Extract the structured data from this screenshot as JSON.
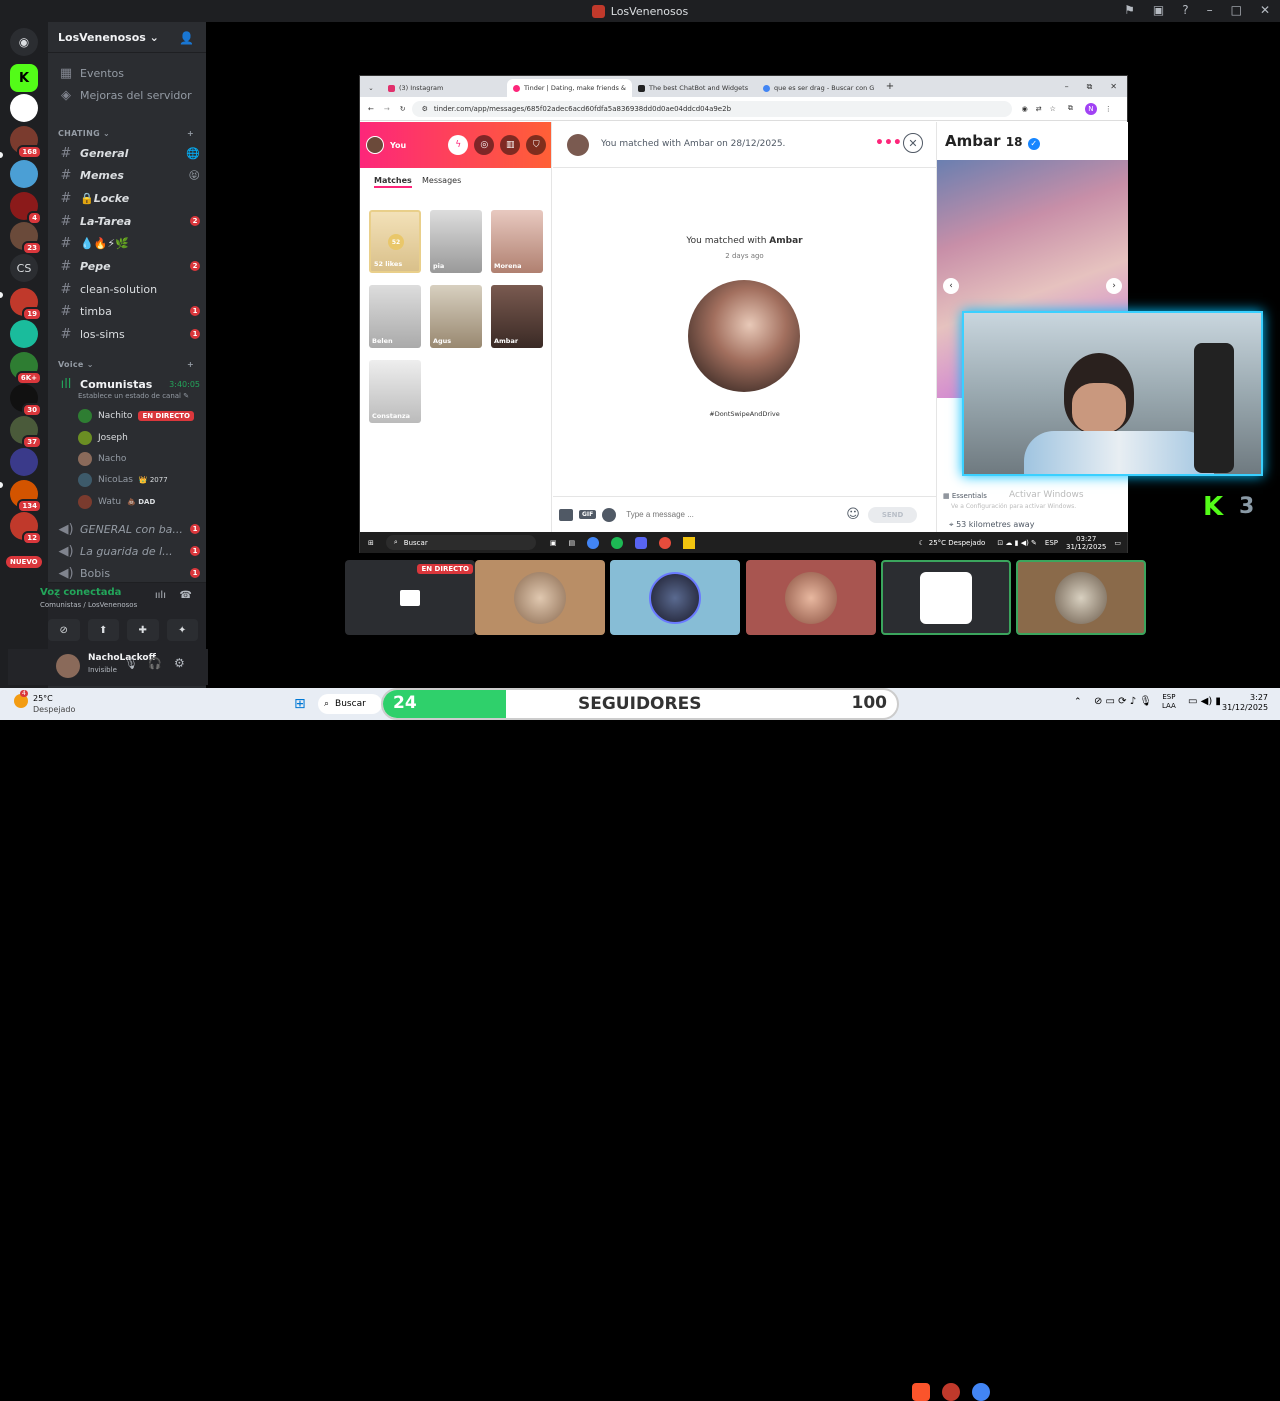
{
  "window_title": "LosVenenosos",
  "server": {
    "name": "LosVenenosos"
  },
  "sidebar_top": [
    {
      "label": "Eventos"
    },
    {
      "label": "Mejoras del servidor"
    }
  ],
  "categories": {
    "text": "CHATING",
    "voice": "Voice"
  },
  "channels": [
    {
      "name": "General",
      "emoji": "🌐",
      "count": ""
    },
    {
      "name": "Memes",
      "emoji": "😝",
      "count": ""
    },
    {
      "name": "Locke",
      "emoji": "🔒",
      "count": ""
    },
    {
      "name": "La-Tarea",
      "emoji": "",
      "count": "2"
    },
    {
      "name": "💧🔥⚡🌿",
      "emoji": "",
      "count": ""
    },
    {
      "name": "Pepe",
      "emoji": "",
      "count": "2"
    },
    {
      "name": "clean-solution",
      "emoji": "",
      "count": ""
    },
    {
      "name": "timba",
      "emoji": "",
      "count": "1"
    },
    {
      "name": "los-sims",
      "emoji": "",
      "count": "1"
    }
  ],
  "voice_channel": {
    "name": "Comunistas",
    "timer": "3:40:05",
    "status": "Establece un estado de canal"
  },
  "voice_users": [
    {
      "name": "Nachito",
      "tag": "EN DIRECTO"
    },
    {
      "name": "Joseph",
      "tag": ""
    },
    {
      "name": "Nacho",
      "tag": ""
    },
    {
      "name": "NicoLas",
      "tag": "👑 2077"
    },
    {
      "name": "Watu",
      "tag": "💩 DAD"
    }
  ],
  "voice_channels_more": [
    {
      "name": "GENERAL con ba...",
      "count": "1"
    },
    {
      "name": "La guarida de l...",
      "count": "1"
    },
    {
      "name": "Bobis",
      "count": "1"
    }
  ],
  "server_badges": [
    "168",
    "4",
    "23",
    "CS",
    "19",
    "6K+",
    "30",
    "37",
    "134",
    "12",
    "NUEVO"
  ],
  "voice_panel": {
    "status": "Voz conectada",
    "channel": "Comunistas / LosVenenosos"
  },
  "user_panel": {
    "name": "NachoLackoff",
    "status": "Invisible"
  },
  "browser": {
    "tabs": [
      {
        "label": "(3) Instagram"
      },
      {
        "label": "Tinder | Dating, make friends &"
      },
      {
        "label": "The best ChatBot and Widgets"
      },
      {
        "label": "que es ser drag - Buscar con G"
      }
    ],
    "url": "tinder.com/app/messages/685f02adec6acd60fdfa5a836938dd0d0ae04ddcd04a9e2b"
  },
  "tinder": {
    "you_label": "You",
    "tab_matches": "Matches",
    "tab_messages": "Messages",
    "matches": [
      {
        "name": "52 likes",
        "extra": "52"
      },
      {
        "name": "pia"
      },
      {
        "name": "Morena"
      },
      {
        "name": "Belen"
      },
      {
        "name": "Agus"
      },
      {
        "name": "Ambar"
      },
      {
        "name": "Constanza"
      }
    ],
    "header_text": "You matched with Ambar on 28/12/2025.",
    "matched_line1": "You matched with",
    "matched_name": "Ambar",
    "matched_ago": "2 days ago",
    "hashtag": "#DontSwipeAndDrive",
    "input_placeholder": "Type a message ...",
    "send_label": "SEND",
    "gif_label": "GIF",
    "profile_name": "Ambar",
    "profile_age": "18",
    "essentials": "Essentials",
    "distance": "53 kilometres away",
    "activate_windows": "Activar Windows",
    "activate_windows_sub": "Ve a Configuración para activar Windows."
  },
  "inner_taskbar": {
    "search": "Buscar",
    "weather": "25°C Despejado",
    "lang": "ESP",
    "time": "03:27",
    "date": "31/12/2025"
  },
  "overlay": {
    "k_count": "3",
    "live_label": "EN DIRECTO"
  },
  "bottom_taskbar": {
    "weather_temp": "25°C",
    "weather_desc": "Despejado",
    "weather_badge": "4",
    "search": "Buscar",
    "followers_count": "24",
    "followers_label": "SEGUIDORES",
    "followers_goal": "100",
    "lang1": "ESP",
    "lang2": "LAA",
    "time": "3:27",
    "date": "31/12/2025"
  },
  "colors": {
    "discord_bg": "#2b2d31",
    "rail_bg": "#1e1f22",
    "tinder_pink": "#fd267a",
    "tinder_orange": "#ff6036",
    "live_red": "#da373c",
    "webcam_glow": "#3ad0ff",
    "followers_green": "#2fd06b"
  }
}
